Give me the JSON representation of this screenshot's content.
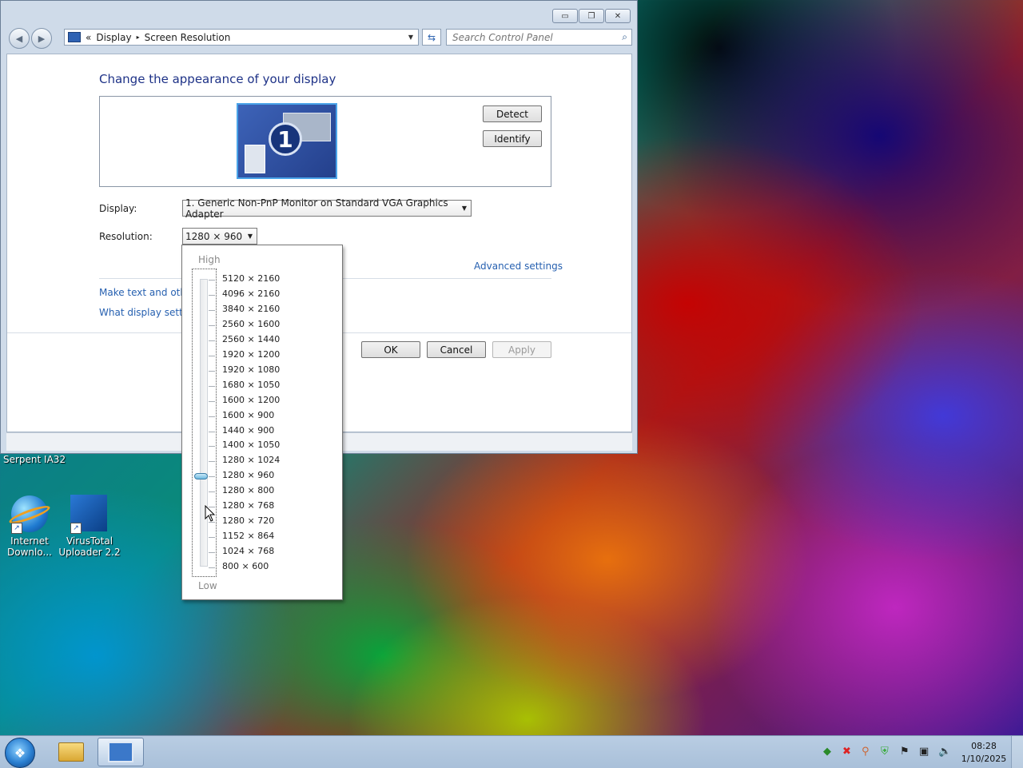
{
  "window": {
    "breadcrumb": {
      "sep": "«",
      "item1": "Display",
      "arrow": "▸",
      "item2": "Screen Resolution"
    },
    "search_placeholder": "Search Control Panel",
    "heading": "Change the appearance of your display",
    "monitor_number": "1",
    "buttons": {
      "detect": "Detect",
      "identify": "Identify",
      "ok": "OK",
      "cancel": "Cancel",
      "apply": "Apply"
    },
    "display_label": "Display:",
    "display_value": "1. Generic Non-PnP Monitor on Standard VGA Graphics Adapter",
    "resolution_label": "Resolution:",
    "resolution_value": "1280 × 960",
    "advanced_link": "Advanced settings",
    "link_text_size": "Make text and other",
    "link_what_display": "What display setting"
  },
  "dropdown": {
    "high": "High",
    "low": "Low",
    "resolutions": [
      "5120 × 2160",
      "4096 × 2160",
      "3840 × 2160",
      "2560 × 1600",
      "2560 × 1440",
      "1920 × 1200",
      "1920 × 1080",
      "1680 × 1050",
      "1600 × 1200",
      "1600 × 900",
      "1440 × 900",
      "1400 × 1050",
      "1280 × 1024",
      "1280 × 960",
      "1280 × 800",
      "1280 × 768",
      "1280 × 720",
      "1152 × 864",
      "1024 × 768",
      "800 × 600"
    ],
    "selected": "1280 × 960"
  },
  "desktop": {
    "window_label": "Serpent IA32",
    "icons": [
      {
        "label1": "Internet",
        "label2": "Downlo..."
      },
      {
        "label1": "VirusTotal",
        "label2": "Uploader 2.2"
      }
    ]
  },
  "taskbar": {
    "time": "08:28",
    "date": "1/10/2025"
  },
  "colors": {
    "link": "#2660b0",
    "heading": "#1e3287",
    "thumb": "#6db9e0"
  }
}
